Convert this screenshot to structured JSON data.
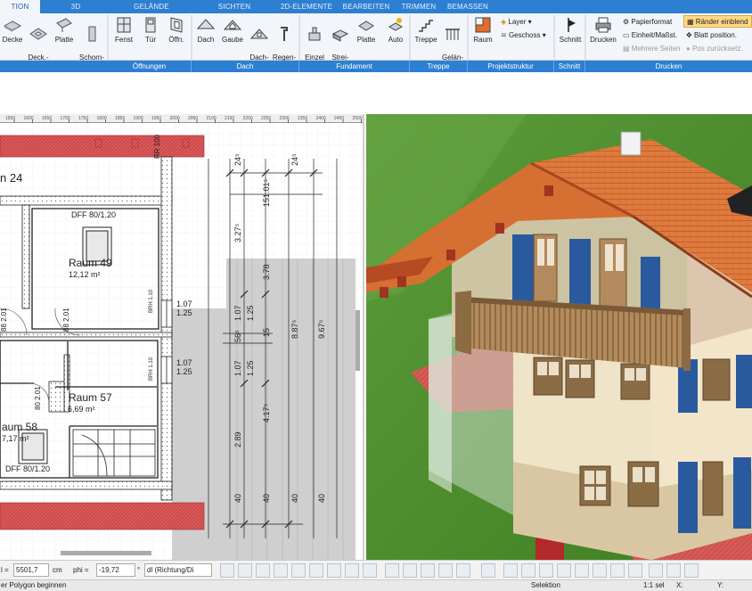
{
  "ribbon": {
    "tabs": [
      "TION",
      "3D",
      "GELÄNDE",
      "SICHTEN",
      "2D-ELEMENTE",
      "BEARBEITEN",
      "TRIMMEN",
      "BEMASSEN"
    ],
    "buttons": [
      {
        "label": "Decke",
        "icon": "ceiling-icon"
      },
      {
        "label": "Deck.-\nöffn.",
        "icon": "ceiling-opening-icon"
      },
      {
        "label": "Platte",
        "icon": "slab-icon"
      },
      {
        "label": "Schorn-\nstein",
        "icon": "chimney-icon"
      },
      {
        "label": "Fenst",
        "icon": "window-icon"
      },
      {
        "label": "Tür",
        "icon": "door-icon"
      },
      {
        "label": "Öffn.",
        "icon": "opening-icon"
      },
      {
        "label": "Dach",
        "icon": "roof-icon"
      },
      {
        "label": "Gaube",
        "icon": "dormer-icon"
      },
      {
        "label": "Dach-\nfenster",
        "icon": "roof-window-icon"
      },
      {
        "label": "Regen-\nfallrohr",
        "icon": "downpipe-icon"
      },
      {
        "label": "Einzel\nFund.",
        "icon": "single-foundation-icon"
      },
      {
        "label": "Strei-\nfen",
        "icon": "strip-foundation-icon"
      },
      {
        "label": "Platte",
        "icon": "foundation-slab-icon"
      },
      {
        "label": "Auto",
        "icon": "auto-foundation-icon"
      },
      {
        "label": "Treppe",
        "icon": "stairs-icon"
      },
      {
        "label": "Gelän-\nder",
        "icon": "railing-icon"
      },
      {
        "label": "Raum",
        "icon": "room-icon"
      },
      {
        "label": "Schnitt",
        "icon": "section-icon"
      },
      {
        "label": "Drucken",
        "icon": "printer-icon"
      }
    ],
    "small": {
      "layer": "Layer ▾",
      "geschoss": "Geschoss ▾",
      "papierformat": "Papierformat",
      "einheit": "Einheit/Maßst.",
      "mehrere": "Mehrere Seiten",
      "raender": "Ränder einblend",
      "blatt": "Blatt position.",
      "pos": "Pos zurücksetz."
    },
    "groups": [
      "Öffnungen",
      "Dach",
      "Fundament",
      "Treppe",
      "Projektstruktur",
      "Schnitt",
      "Drucken"
    ]
  },
  "plan": {
    "ruler": [
      "1550",
      "1600",
      "1650",
      "1700",
      "1750",
      "1800",
      "1850",
      "1900",
      "1950",
      "2000",
      "2050",
      "2100",
      "2150",
      "2200",
      "2250",
      "2300",
      "2350",
      "2400",
      "2450",
      "2500"
    ],
    "rooms": [
      {
        "name": "n 24",
        "area": ""
      },
      {
        "name": "Raum 49",
        "area": "12,12 m²"
      },
      {
        "name": "Raum 57",
        "area": "6,69 m²"
      },
      {
        "name": "aum 58",
        "area": "7,17 m²"
      }
    ],
    "labels": {
      "dff1": "DFF  80/1.20",
      "dff2": "DFF  80/1.20",
      "rr": "RR 100",
      "brh1": "BRH 1.10",
      "brh2": "BRH 1.10",
      "w1a": "1.07",
      "w1b": "1.25",
      "w2a": "1.07",
      "w2b": "1.25",
      "d1a": "88",
      "d1b": "2.01",
      "d2a": "88",
      "d2b": "2.01",
      "d3a": "80",
      "d3b": "2.01",
      "d4": "88"
    },
    "dims": {
      "top1": "24⁵",
      "top2": "24⁵",
      "v151": "151.01⁵",
      "v327": "3.27⁵",
      "v378": "3.78",
      "v887": "8.87⁵",
      "v967": "9.67⁵",
      "v107a": "1.07",
      "v107b": "1.07",
      "v125a": "1.25",
      "v125b": "1.25",
      "v56": "56⁵",
      "v15": "15",
      "v417": "4.17⁵",
      "v289": "2.89",
      "b40a": "40",
      "b40b": "40",
      "b40c": "40",
      "b40d": "40"
    }
  },
  "bottombar": {
    "l_label": "l =",
    "l_value": "5501,7",
    "l_unit": "cm",
    "phi_label": "phi =",
    "phi_value": "-19,72",
    "phi_unit": "°",
    "dl_value": "dl (Richtung/Di"
  },
  "status": {
    "hint": "er Polygon beginnen",
    "mode": "Selektion",
    "sel": "1:1 sel",
    "x": "X:",
    "y": "Y:"
  }
}
